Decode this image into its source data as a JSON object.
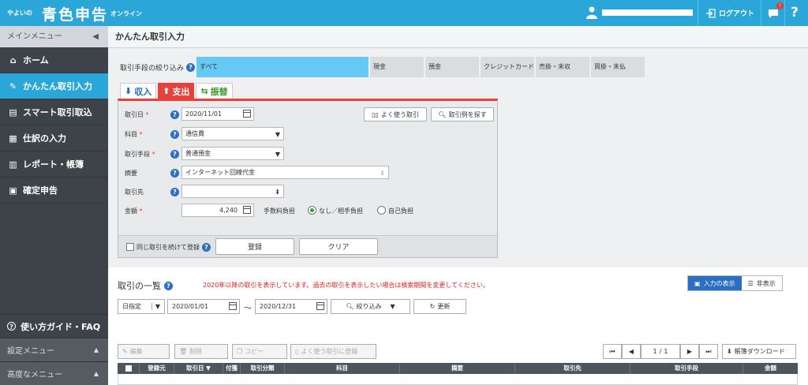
{
  "topbar": {
    "logo_small": "やよいの",
    "logo_main": "青色申告",
    "logo_suffix": "オンライン",
    "logout": "ログアウト",
    "notification_count": "!",
    "help": "?"
  },
  "sidebar": {
    "header": "メインメニュー",
    "items": [
      {
        "label": "ホーム",
        "icon": "home-icon"
      },
      {
        "label": "かんたん取引入力",
        "icon": "pencil-icon",
        "active": true
      },
      {
        "label": "スマート取引取込",
        "icon": "import-icon"
      },
      {
        "label": "仕訳の入力",
        "icon": "journal-icon"
      },
      {
        "label": "レポート・帳簿",
        "icon": "chart-icon"
      },
      {
        "label": "確定申告",
        "icon": "document-icon"
      }
    ],
    "guide": "使い方ガイド・FAQ",
    "settings": "設定メニュー",
    "advanced": "高度なメニュー"
  },
  "page": {
    "title": "かんたん取引入力"
  },
  "filter": {
    "label": "取引手段の絞り込み",
    "tabs": [
      "すべて",
      "現金",
      "預金",
      "クレジットカード",
      "売掛・未収",
      "買掛・未払"
    ]
  },
  "form": {
    "tabs": {
      "income": "収入",
      "expense": "支出",
      "transfer": "振替"
    },
    "date_label": "取引日",
    "date_value": "2020/11/01",
    "frequent_button": "よく使う取引",
    "examples_button": "取引例を探す",
    "account_label": "科目",
    "account_value": "通信費",
    "method_label": "取引手段",
    "method_value": "普通預金",
    "summary_label": "摘要",
    "summary_value": "インターネット回線代金",
    "partner_label": "取引先",
    "partner_value": "",
    "amount_label": "金額",
    "amount_value": "4,240",
    "fee_label": "手数料負担",
    "fee_option_none": "なし／相手負担",
    "fee_option_self": "自己負担",
    "continue_label": "同じ取引を続けて登録",
    "register_button": "登録",
    "clear_button": "クリア"
  },
  "list": {
    "title": "取引の一覧",
    "note": "2020年以降の取引を表示しています。過去の取引を表示したい場合は検索期間を変更してください。",
    "view_show": "入力の表示",
    "view_hide": "非表示",
    "date_mode": "日指定",
    "date_from": "2020/01/01",
    "date_sep": "～",
    "date_to": "2020/12/31",
    "filter_button": "絞り込み",
    "refresh_button": "更新",
    "edit_button": "編集",
    "delete_button": "削除",
    "copy_button": "コピー",
    "save_frequent_button": "よく使う取引に登録",
    "page_current": "1",
    "page_sep": "/",
    "page_total": "1",
    "download_button": "帳簿ダウンロード",
    "columns": [
      "登録元",
      "取引日 ▼",
      "付箋",
      "取引分類",
      "科目",
      "摘要",
      "取引先",
      "取引手段",
      "金額"
    ]
  },
  "colors": {
    "accent": "#2aa7d8",
    "expense": "#e6413b",
    "income": "#1f6fbf",
    "transfer": "#3c9a2a",
    "sidebar": "#3d4349"
  }
}
